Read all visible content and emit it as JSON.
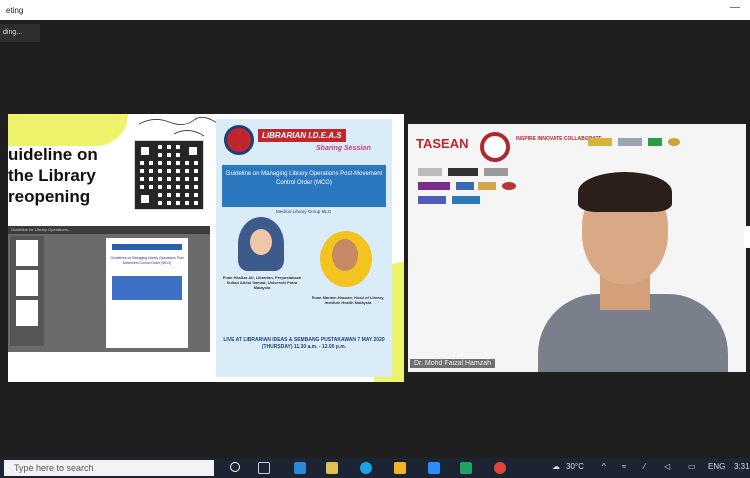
{
  "window": {
    "title": "eting",
    "minimize_glyph": "—"
  },
  "recording_badge": "ding...",
  "shared_screen": {
    "headline": [
      "uideline on",
      "the Library",
      "reopening"
    ],
    "doc_window_title": "Guideline for Library Operations...",
    "doc_page_title": "Guidelines on Managing Library Operations Post Movement Control Order (MCO)",
    "poster": {
      "brand": "LIBRARIAN I.D.E.A.S",
      "sharing": "Sharing Session",
      "band_title": "Guideline on Managing Library Operations Post-Movement Control Order (MCO)",
      "sub": "Medical Library Group MLG",
      "caption1": "Puan Hasliza Ali, Librarian, Perpustakaan Sultan Abdul Samad, Universiti Putra Malaysia",
      "caption2": "Puan Mariam Hassan, Head of Library, Institute Health Malaysia",
      "live": "LIVE AT LIBRARIAN IDEAS & SEMBANG PUSTAKAWAN 7 MAY 2020 (THURSDAY) 11.30 a.m. - 12.00 p.m."
    }
  },
  "video": {
    "logo_text": "TASEAN",
    "innovate_text": "INSPIRE INNOVATE COLLABORATE",
    "speaker_name": "Dr. Mohd Faizal Hamzah"
  },
  "taskbar": {
    "search_placeholder": "Type here to search",
    "weather": "30°C",
    "language": "ENG",
    "time": "3:31"
  },
  "colors": {
    "accent_yellow": "#eef36b",
    "brand_red": "#c0262c",
    "poster_blue": "#2b78c0",
    "taskbar": "#1c2433"
  }
}
